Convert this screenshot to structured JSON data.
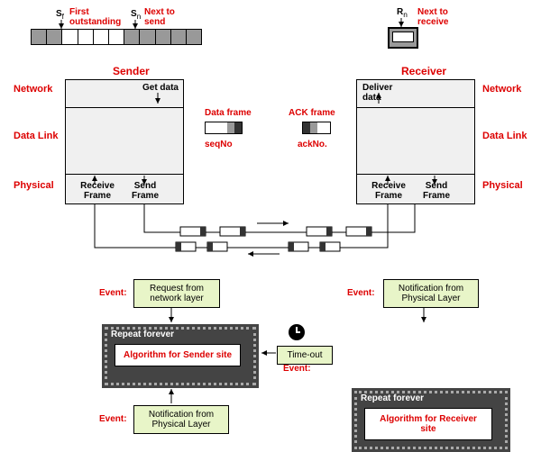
{
  "windows": {
    "Sf": "S",
    "Sf_sub": "f",
    "Sf_label": "First outstanding",
    "Sn": "S",
    "Sn_sub": "n",
    "Sn_label": "Next to send",
    "Rn": "R",
    "Rn_sub": "n",
    "Rn_label": "Next to receive"
  },
  "sender": {
    "title": "Sender",
    "getData": "Get data",
    "recv": "Receive Frame",
    "send": "Send Frame"
  },
  "receiver": {
    "title": "Receiver",
    "deliver": "Deliver data",
    "recv": "Receive Frame",
    "send": "Send Frame"
  },
  "layers": {
    "network": "Network",
    "datalink": "Data Link",
    "physical": "Physical"
  },
  "frames": {
    "dataFrame": "Data frame",
    "seqNo": "seqNo",
    "ackFrame": "ACK frame",
    "ackNo": "ackNo."
  },
  "events": {
    "event": "Event:",
    "reqNet": "Request from network layer",
    "notifPhys": "Notification from Physical Layer",
    "timeout": "Time-out",
    "repeat": "Repeat forever",
    "algoSender": "Algorithm for Sender site",
    "algoReceiver": "Algorithm for Receiver site"
  }
}
